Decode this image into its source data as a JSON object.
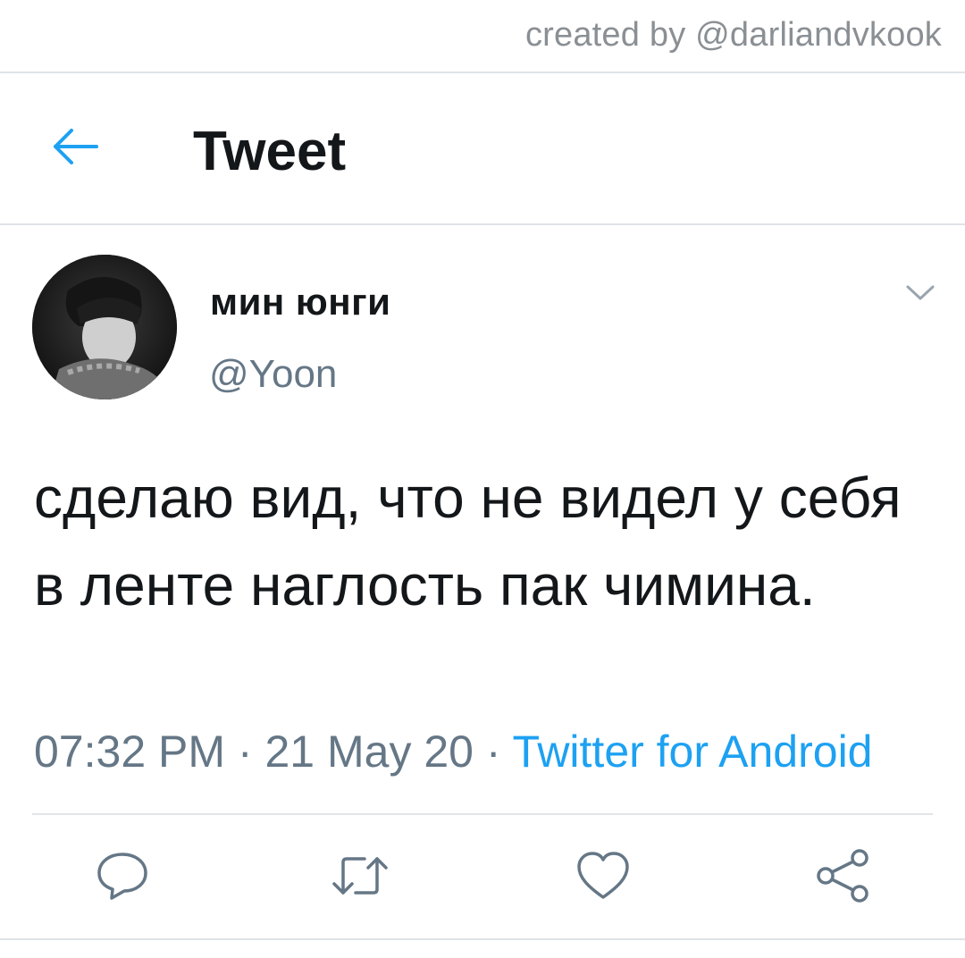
{
  "credit": "created by @darliandvkook",
  "header": {
    "title": "Tweet",
    "back_icon": "arrow-left-icon"
  },
  "tweet": {
    "display_name": "мин юнги",
    "handle": "@Yoon",
    "text": "сделаю вид, что не видел у себя в ленте наглость пак чимина.",
    "time": "07:32 PM",
    "date": "21 May 20",
    "separator": "·",
    "source": "Twitter for Android"
  },
  "actions": [
    "reply-icon",
    "retweet-icon",
    "like-icon",
    "share-icon"
  ],
  "colors": {
    "accent": "#1da1f2",
    "text": "#14171a",
    "secondary": "#657786",
    "divider": "#dfe3e7"
  }
}
